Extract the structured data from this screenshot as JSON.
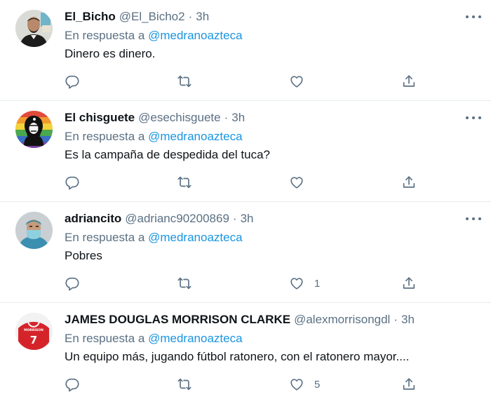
{
  "reply_prefix": "En respuesta a",
  "tweets": [
    {
      "name": "El_Bicho",
      "handle": "@El_Bicho2",
      "separator": "·",
      "time": "3h",
      "mention": "@medranoazteca",
      "text": "Dinero es dinero.",
      "likes": ""
    },
    {
      "name": "El chisguete",
      "handle": "@esechisguete",
      "separator": "·",
      "time": "3h",
      "mention": "@medranoazteca",
      "text": "Es la campaña de despedida del tuca?",
      "likes": ""
    },
    {
      "name": "adriancito",
      "handle": "@adrianc90200869",
      "separator": "·",
      "time": "3h",
      "mention": "@medranoazteca",
      "text": "Pobres",
      "likes": "1"
    },
    {
      "name": "JAMES DOUGLAS MORRISON CLARKE",
      "handle": "@alexmorrisongdl",
      "separator": "·",
      "time": "3h",
      "mention": "@medranoazteca",
      "text": "Un equipo más, jugando fútbol ratonero, con el ratonero mayor....",
      "likes": "5",
      "avatar_text": "MORRISON",
      "avatar_number": "7"
    }
  ],
  "icons": [
    "reply-icon",
    "retweet-icon",
    "like-icon",
    "share-icon",
    "more-icon"
  ],
  "colors": {
    "text": "#0f1419",
    "secondary": "#5b7083",
    "link": "#1b95e0",
    "divider": "#e6ecf0"
  }
}
